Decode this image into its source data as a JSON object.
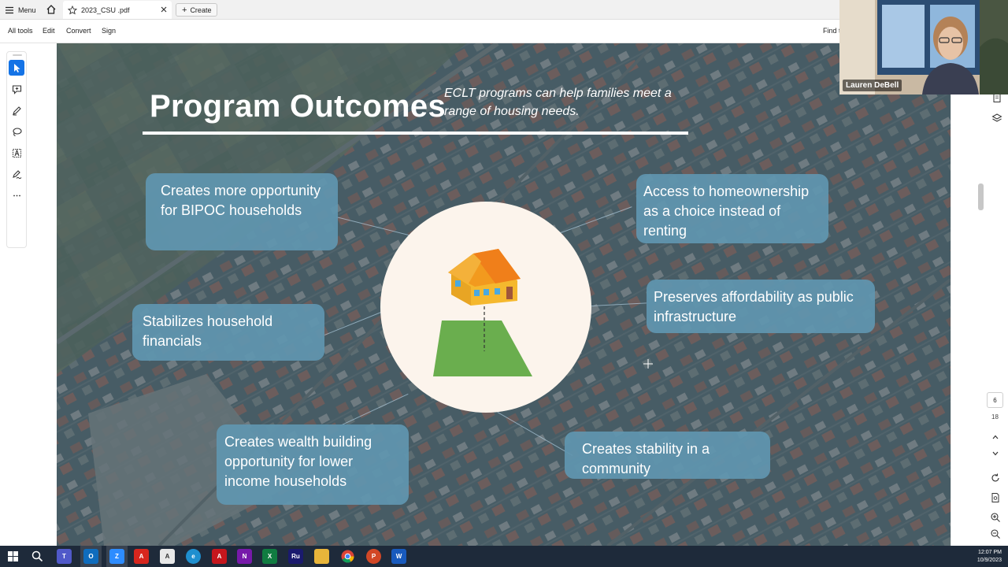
{
  "tabbar": {
    "menu_label": "Menu",
    "doc_tab_title": "2023_CSU .pdf",
    "create_label": "Create"
  },
  "toolbar": {
    "items": [
      "All tools",
      "Edit",
      "Convert",
      "Sign"
    ],
    "find_text": "Find t"
  },
  "left_tools": [
    "select-cursor-icon",
    "add-comment-icon",
    "highlight-pen-icon",
    "draw-lasso-icon",
    "text-select-icon",
    "fill-sign-icon",
    "more-options-icon"
  ],
  "right_rail": {
    "page_current": "6",
    "page_total": "18"
  },
  "slide": {
    "title": "Program Outcomes",
    "subtitle": "ECLT programs can help families meet a range of housing needs.",
    "outcomes": [
      "Creates more opportunity for BIPOC households",
      "Access to homeownership as a choice instead of renting",
      "Preserves affordability as public infrastructure",
      "Stabilizes household financials",
      "Creates wealth building opportunity for lower income households",
      "Creates stability in a community"
    ]
  },
  "webcam": {
    "participant_name": "Lauren DeBell"
  },
  "taskbar": {
    "apps": [
      "start-icon",
      "search-icon",
      "teams-icon",
      "outlook-icon",
      "zoom-icon",
      "acrobat-icon",
      "acrobat-sign-icon",
      "edge-icon",
      "acrobat-reader-icon",
      "onenote-icon",
      "excel-icon",
      "rush-icon",
      "file-explorer-icon",
      "chrome-icon",
      "powerpoint-icon",
      "word-icon"
    ],
    "time": "12:07 PM",
    "date": "10/9/2023"
  },
  "colors": {
    "accent_blue": "#1473e6",
    "outcome_box": "#6096af",
    "circle_fill": "#fcf4ec",
    "lawn_green": "#6aae4e",
    "house_yellow": "#f5b82e",
    "roof_orange": "#f29a1e"
  }
}
